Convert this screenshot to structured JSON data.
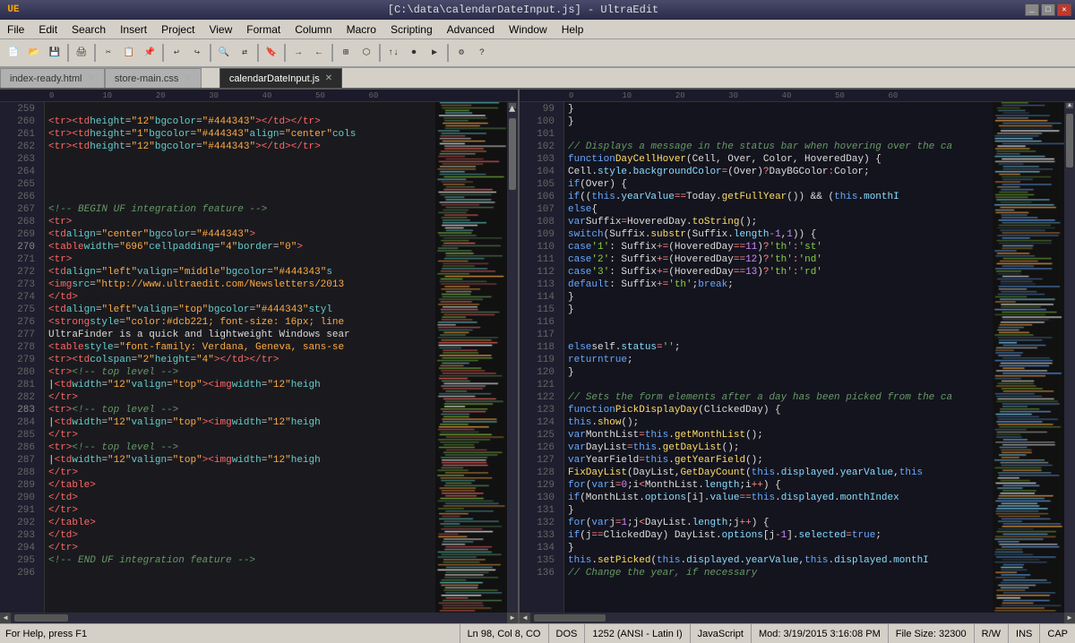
{
  "titleBar": {
    "title": "[C:\\data\\calendarDateInput.js] - UltraEdit",
    "icon": "UE",
    "controls": [
      "_",
      "□",
      "✕"
    ]
  },
  "menuBar": {
    "items": [
      "File",
      "Edit",
      "Search",
      "Insert",
      "Project",
      "View",
      "Format",
      "Column",
      "Macro",
      "Scripting",
      "Advanced",
      "Window",
      "Help"
    ]
  },
  "tabs": {
    "group1": [
      {
        "label": "index-ready.html",
        "active": false
      },
      {
        "label": "store-main.css",
        "active": false
      }
    ],
    "group2": [
      {
        "label": "calendarDateInput.js",
        "active": true
      }
    ]
  },
  "leftEditor": {
    "lines": [
      {
        "num": 259,
        "code": ""
      },
      {
        "num": 260,
        "code": "    <tr><td height=\"12\" bgcolor=\"#444343\"></td></tr>"
      },
      {
        "num": 261,
        "code": "    <tr><td height=\"1\" bgcolor=\"#444343\" align=\"center\" cols"
      },
      {
        "num": 262,
        "code": "    <tr><td height=\"12\" bgcolor=\"#444343\"></td></tr>"
      },
      {
        "num": 263,
        "code": ""
      },
      {
        "num": 264,
        "code": ""
      },
      {
        "num": 265,
        "code": ""
      },
      {
        "num": 266,
        "code": ""
      },
      {
        "num": 267,
        "code": "    <!-- BEGIN UF integration feature -->"
      },
      {
        "num": 268,
        "code": "    <tr>"
      },
      {
        "num": 269,
        "code": "      <td align=\"center\" bgcolor=\"#444343\">"
      },
      {
        "num": 270,
        "code": "        <table width=\"696\" cellpadding=\"4\" border=\"0\">"
      },
      {
        "num": 271,
        "code": "          <tr>"
      },
      {
        "num": 272,
        "code": "            <td align=\"left\" valign=\"middle\" bgcolor=\"#444343\" s"
      },
      {
        "num": 273,
        "code": "              <img src=\"http://www.ultraedit.com/Newsletters/2013"
      },
      {
        "num": 274,
        "code": "            </td>"
      },
      {
        "num": 275,
        "code": "            <td align=\"left\" valign=\"top\" bgcolor=\"#444343\" styl"
      },
      {
        "num": 276,
        "code": "              <strong style=\"color:#dcb221; font-size: 16px; line"
      },
      {
        "num": 277,
        "code": "              UltraFinder is a quick and lightweight Windows sear"
      },
      {
        "num": 278,
        "code": "              <table style=\"font-family: Verdana, Geneva, sans-se"
      },
      {
        "num": 279,
        "code": "                <tr><td colspan=\"2\" height=\"4\"></td></tr>"
      },
      {
        "num": 280,
        "code": "                <tr><!-- top level -->"
      },
      {
        "num": 281,
        "code": "                |<td width=\"12\" valign=\"top\"><img width=\"12\" heigh"
      },
      {
        "num": 282,
        "code": "                </tr>"
      },
      {
        "num": 283,
        "code": "                <tr><!-- top level -->"
      },
      {
        "num": 284,
        "code": "                |<td width=\"12\" valign=\"top\"><img width=\"12\" heigh"
      },
      {
        "num": 285,
        "code": "                </tr>"
      },
      {
        "num": 286,
        "code": "                <tr><!-- top level -->"
      },
      {
        "num": 287,
        "code": "                |<td width=\"12\" valign=\"top\"><img width=\"12\" heigh"
      },
      {
        "num": 288,
        "code": "                </tr>"
      },
      {
        "num": 289,
        "code": "              </table>"
      },
      {
        "num": 290,
        "code": "            </td>"
      },
      {
        "num": 291,
        "code": "          </tr>"
      },
      {
        "num": 292,
        "code": "        </table>"
      },
      {
        "num": 293,
        "code": "      </td>"
      },
      {
        "num": 294,
        "code": "    </tr>"
      },
      {
        "num": 295,
        "code": "    <!-- END UF integration feature -->"
      },
      {
        "num": 296,
        "code": ""
      }
    ]
  },
  "rightEditor": {
    "lines": [
      {
        "num": 99,
        "code": "    }"
      },
      {
        "num": 100,
        "code": "}"
      },
      {
        "num": 101,
        "code": ""
      },
      {
        "num": 102,
        "code": "// Displays a message in the status bar when hovering over the ca"
      },
      {
        "num": 103,
        "code": "function DayCellHover(Cell, Over, Color, HoveredDay) {"
      },
      {
        "num": 104,
        "code": "    Cell.style.backgroundColor = (Over) ? DayBGColor : Color;"
      },
      {
        "num": 105,
        "code": "    if (Over) {"
      },
      {
        "num": 106,
        "code": "        if ((this.yearValue == Today.getFullYear()) && (this.monthI"
      },
      {
        "num": 107,
        "code": "        else {"
      },
      {
        "num": 108,
        "code": "            var Suffix = HoveredDay.toString();"
      },
      {
        "num": 109,
        "code": "            switch (Suffix.substr(Suffix.length - 1, 1)) {"
      },
      {
        "num": 110,
        "code": "                case '1' : Suffix += (HoveredDay == 11) ? 'th' : 'st'"
      },
      {
        "num": 111,
        "code": "                case '2' : Suffix += (HoveredDay == 12) ? 'th' : 'nd'"
      },
      {
        "num": 112,
        "code": "                case '3' : Suffix += (HoveredDay == 13) ? 'th' : 'rd'"
      },
      {
        "num": 113,
        "code": "                default : Suffix += 'th'; break;"
      },
      {
        "num": 114,
        "code": "            }"
      },
      {
        "num": 115,
        "code": "        }"
      },
      {
        "num": 116,
        "code": ""
      },
      {
        "num": 117,
        "code": ""
      },
      {
        "num": 118,
        "code": "    else self.status = '';"
      },
      {
        "num": 119,
        "code": "    return true;"
      },
      {
        "num": 120,
        "code": "}"
      },
      {
        "num": 121,
        "code": ""
      },
      {
        "num": 122,
        "code": "// Sets the form elements after a day has been picked from the ca"
      },
      {
        "num": 123,
        "code": "function PickDisplayDay(ClickedDay) {"
      },
      {
        "num": 124,
        "code": "    this.show();"
      },
      {
        "num": 125,
        "code": "    var MonthList = this.getMonthList();"
      },
      {
        "num": 126,
        "code": "    var DayList = this.getDayList();"
      },
      {
        "num": 127,
        "code": "    var YearField = this.getYearField();"
      },
      {
        "num": 128,
        "code": "    FixDayList(DayList, GetDayCount(this.displayed.yearValue, this"
      },
      {
        "num": 129,
        "code": "    for (var i=0;i<MonthList.length;i++) {"
      },
      {
        "num": 130,
        "code": "        if (MonthList.options[i].value == this.displayed.monthIndex"
      },
      {
        "num": 131,
        "code": "    }"
      },
      {
        "num": 132,
        "code": "    for (var j=1;j< DayList.length;j++) {"
      },
      {
        "num": 133,
        "code": "        if (j == ClickedDay) DayList.options[j-1].selected = true;"
      },
      {
        "num": 134,
        "code": "    }"
      },
      {
        "num": 135,
        "code": "    this.setPicked(this.displayed.yearValue, this.displayed.monthI"
      },
      {
        "num": 136,
        "code": "    // Change the year, if necessary"
      }
    ]
  },
  "statusBar": {
    "help": "For Help, press F1",
    "position": "Ln 98, Col 8, CO",
    "encoding": "DOS",
    "codepage": "1252 (ANSI - Latin I)",
    "language": "JavaScript",
    "modified": "Mod: 3/19/2015 3:16:08 PM",
    "fileSize": "File Size: 32300",
    "mode": "R/W",
    "insert": "INS",
    "caps": "CAP"
  },
  "colors": {
    "background": "#1a1a2a",
    "lineNumBg": "#1e1e2e",
    "editorBg": "#1a1a2a",
    "titleBg": "#2a2a4a",
    "menuBg": "#d4d0c8",
    "statusBg": "#d4d0c8"
  }
}
